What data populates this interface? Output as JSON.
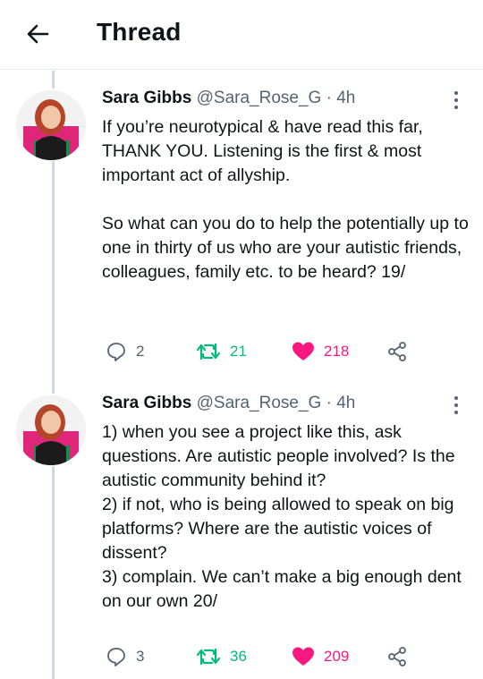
{
  "header": {
    "title": "Thread"
  },
  "tweets": [
    {
      "author_name": "Sara Gibbs",
      "handle": "@Sara_Rose_G",
      "separator": "·",
      "time": "4h",
      "text": "If you’re neurotypical & have read this far, THANK YOU. Listening is the first & most important act of allyship.\n\nSo what can you do to help the potentially up to one in thirty of us who are your autistic friends, colleagues, family etc. to be heard? 19/",
      "replies": "2",
      "retweets": "21",
      "likes": "218",
      "liked": true,
      "retweeted": true
    },
    {
      "author_name": "Sara Gibbs",
      "handle": "@Sara_Rose_G",
      "separator": "·",
      "time": "4h",
      "text": "1) when you see a project like this, ask questions. Are autistic people involved? Is the autistic community behind it?\n2) if not, who is being allowed to speak on big platforms? Where are the autistic voices of dissent?\n3) complain. We can’t make a big enough dent on our own 20/",
      "replies": "3",
      "retweets": "36",
      "likes": "209",
      "liked": true,
      "retweeted": true
    }
  ],
  "colors": {
    "like": "#f91880",
    "retweet": "#00ba7c",
    "muted": "#536471",
    "thread_line": "#cfd9de",
    "avatar_top": "#e0267a"
  },
  "icons": {
    "back": "arrow-left-icon",
    "more": "vertical-dots-icon",
    "reply": "speech-bubble-icon",
    "retweet": "retweet-arrows-icon",
    "like": "heart-icon",
    "share": "share-nodes-icon"
  }
}
